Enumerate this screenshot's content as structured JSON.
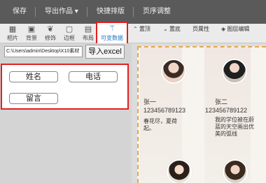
{
  "topbar": {
    "items": [
      "保存",
      "导出作品",
      "快捷排版",
      "页序调整"
    ],
    "export_caret": "▾"
  },
  "toolbar": {
    "tools": [
      {
        "label": "相片",
        "icon": "photo-icon",
        "glyph": "▦"
      },
      {
        "label": "背景",
        "icon": "background-icon",
        "glyph": "▣"
      },
      {
        "label": "修饰",
        "icon": "leaf-icon",
        "glyph": "❦"
      },
      {
        "label": "边框",
        "icon": "frame-icon",
        "glyph": "▢"
      },
      {
        "label": "布局",
        "icon": "layout-icon",
        "glyph": "▤"
      }
    ],
    "variable_data": {
      "label": "可变数据",
      "icon": "magic-wand-icon",
      "glyph": "⚚"
    },
    "right_tools": [
      {
        "label": "置顶",
        "icon": "bring-top-icon",
        "glyph": "⌃"
      },
      {
        "label": "置底",
        "icon": "send-bottom-icon",
        "glyph": "⌄"
      },
      {
        "label": "页属性",
        "icon": "page-props-icon",
        "glyph": ""
      },
      {
        "label": "图层编辑",
        "icon": "layers-icon",
        "glyph": "◈"
      }
    ]
  },
  "import": {
    "path": "C:\\Users\\admin\\Desktop\\X10素材",
    "button_label": "导入excel"
  },
  "fields": [
    "姓名",
    "电话",
    "留言"
  ],
  "cards": [
    {
      "name": "张一",
      "phone": "123456789123",
      "note": "春花尽，夏荷起。",
      "avatar": "avatar-1"
    },
    {
      "name": "张二",
      "phone": "123456789122",
      "note": "我的学位被在蔚蓝的天空画出优美的弧线",
      "avatar": "avatar-2"
    }
  ]
}
